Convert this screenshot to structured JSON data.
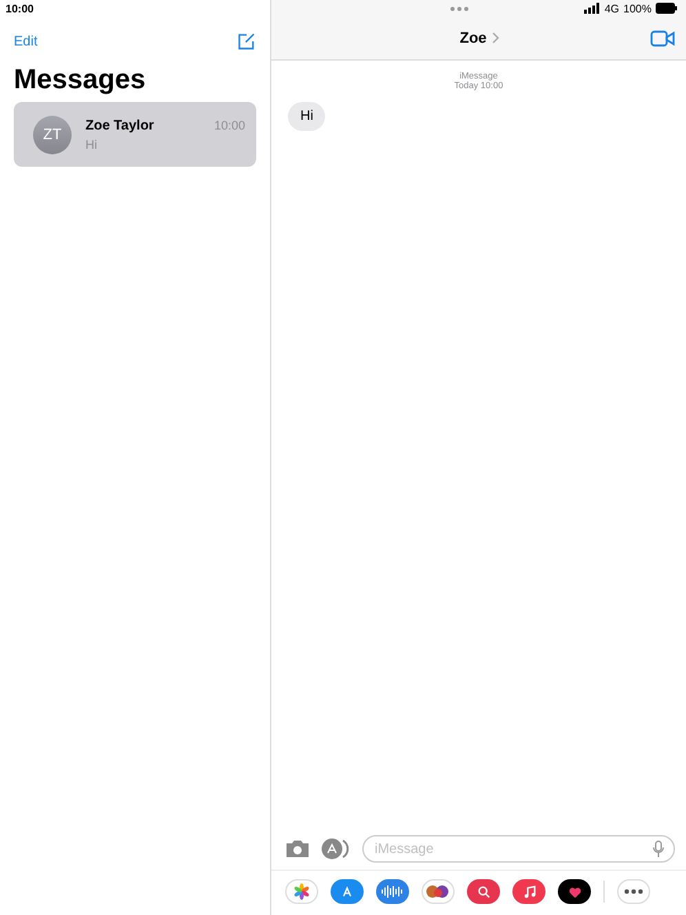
{
  "status_bar": {
    "time": "10:00",
    "network": "4G",
    "battery": "100%"
  },
  "sidebar": {
    "edit": "Edit",
    "title": "Messages",
    "conversations": [
      {
        "initials": "ZT",
        "name": "Zoe Taylor",
        "preview": "Hi",
        "time": "10:00",
        "selected": true
      }
    ]
  },
  "chat": {
    "contact": "Zoe",
    "service": "iMessage",
    "timestamp": "Today 10:00",
    "messages": [
      {
        "text": "Hi"
      }
    ]
  },
  "compose": {
    "placeholder": "iMessage"
  }
}
